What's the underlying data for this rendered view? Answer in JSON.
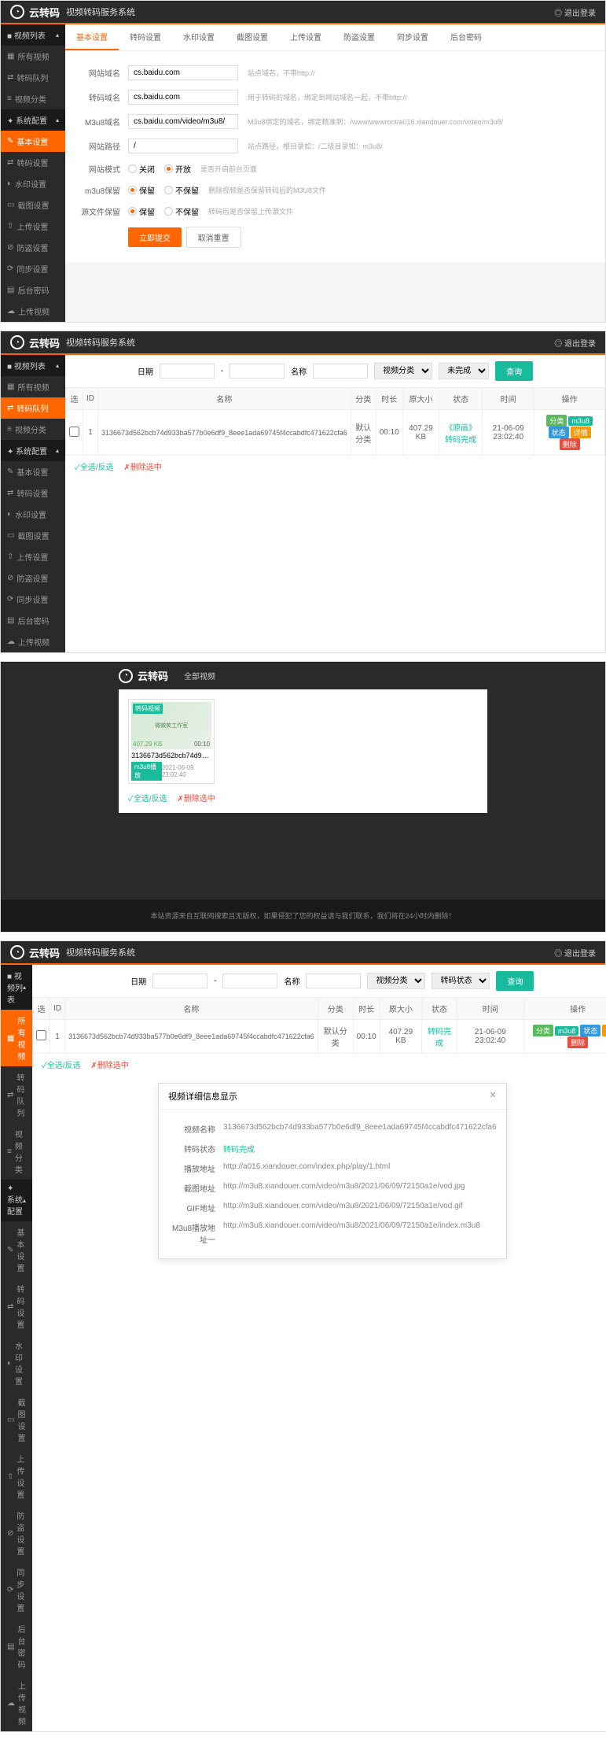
{
  "header": {
    "logo": "云转码",
    "title": "视频转码服务系统",
    "logout": "◎ 退出登录"
  },
  "sidebar": {
    "group1": "视频列表",
    "items1": [
      "所有视频",
      "转码队列",
      "视频分类"
    ],
    "group2": "系统配置",
    "items2": [
      "基本设置",
      "转码设置",
      "水印设置",
      "截图设置",
      "上传设置",
      "防盗设置",
      "同步设置",
      "后台密码",
      "上传视频"
    ]
  },
  "panel1": {
    "tabs": [
      "基本设置",
      "转码设置",
      "水印设置",
      "截图设置",
      "上传设置",
      "防盗设置",
      "同步设置",
      "后台密码"
    ],
    "fields": {
      "domain_label": "网站域名",
      "domain_value": "cs.baidu.com",
      "domain_help": "站点域名，不带http://",
      "transcode_label": "转码域名",
      "transcode_value": "cs.baidu.com",
      "transcode_help": "用于转码的域名，绑定到网站域名一起，不带http://",
      "m3u8_label": "M3u8域名",
      "m3u8_value": "cs.baidu.com/video/m3u8/",
      "m3u8_help": "M3u8绑定的域名，绑定精准到：/www/wwwroot/a016.xiandouer.com/video/m3u8/",
      "path_label": "网站路径",
      "path_value": "/",
      "path_help": "站点路径，根目录如：/二级目录如：m3u8/",
      "mode_label": "网站模式",
      "mode_off": "关闭",
      "mode_on": "开放",
      "mode_help": "是否开启前台页面",
      "m3u8save_label": "m3u8保留",
      "save_yes": "保留",
      "save_no": "不保留",
      "m3u8save_help": "删除视频是否保留转码后的M3U8文件",
      "source_label": "源文件保留",
      "source_help": "转码后是否保留上传源文件",
      "submit": "立即提交",
      "reset": "取消重置"
    }
  },
  "panel2": {
    "toolbar": {
      "date_label": "日期",
      "sep": "-",
      "name_label": "名称",
      "cat_label": "视频分类",
      "status_label": "未完成",
      "search": "查询"
    },
    "table": {
      "headers": [
        "选",
        "ID",
        "名称",
        "分类",
        "时长",
        "原大小",
        "状态",
        "时间",
        "操作"
      ],
      "row": {
        "id": "1",
        "name": "3136673d562bcb74d933ba577b0e6df9_8eee1ada69745f4ccabdfc471622cfa6",
        "cat": "默认分类",
        "duration": "00:10",
        "size": "407.29 KB",
        "status": "《原画》转码完成",
        "time": "21-06-09 23:02:40"
      },
      "ops": [
        "分类",
        "m3u8",
        "状态",
        "详情",
        "删除"
      ]
    },
    "actions": {
      "select_all": "✓全选/反选",
      "delete_sel": "✗删除选中"
    }
  },
  "panel3": {
    "nav": "全部视频",
    "card": {
      "badge": "转码视频",
      "size": "407.29 KB",
      "duration": "00:10",
      "title": "3136673d562bcb74d933ba5...",
      "m3u8": "m3u8播放",
      "date": "2021-06-09 23:02:40",
      "thumb_text": "微微笑工作室"
    },
    "actions": {
      "select_all": "✓全选/反选",
      "delete_sel": "✗删除选中"
    },
    "footer": "本站资源来自互联网搜索且无版权，如果侵犯了您的权益请与我们联系，我们将在24小时内删除！"
  },
  "panel4": {
    "toolbar": {
      "date_label": "日期",
      "sep": "-",
      "name_label": "名称",
      "cat_label": "视频分类",
      "status_label": "转码状态",
      "search": "查询"
    },
    "table": {
      "headers": [
        "选",
        "ID",
        "名称",
        "分类",
        "时长",
        "原大小",
        "状态",
        "时间",
        "操作"
      ],
      "row": {
        "id": "1",
        "name": "3136673d562bcb74d933ba577b0e6df9_8eee1ada69745f4ccabdfc471622cfa6",
        "cat": "默认分类",
        "duration": "00:10",
        "size": "407.29 KB",
        "status": "转码完成",
        "time": "21-06-09 23:02:40"
      },
      "ops": [
        "分类",
        "m3u8",
        "状态",
        "详情",
        "删除"
      ]
    },
    "actions": {
      "select_all": "✓全选/反选",
      "delete_sel": "✗删除选中"
    },
    "modal": {
      "title": "视频详细信息显示",
      "rows": [
        {
          "label": "视频名称",
          "value": "3136673d562bcb74d933ba577b0e6df9_8eee1ada69745f4ccabdfc471622cfa6"
        },
        {
          "label": "转码状态",
          "value": "转码完成",
          "green": true
        },
        {
          "label": "播放地址",
          "value": "http://a016.xiandouer.com/index.php/play/1.html"
        },
        {
          "label": "截图地址",
          "value": "http://m3u8.xiandouer.com/video/m3u8/2021/06/09/72150a1e/vod.jpg"
        },
        {
          "label": "GIF地址",
          "value": "http://m3u8.xiandouer.com/video/m3u8/2021/06/09/72150a1e/vod.gif"
        },
        {
          "label": "M3u8播放地址一",
          "value": "http://m3u8.xiandouer.com/video/m3u8/2021/06/09/72150a1e/index.m3u8"
        }
      ]
    }
  }
}
